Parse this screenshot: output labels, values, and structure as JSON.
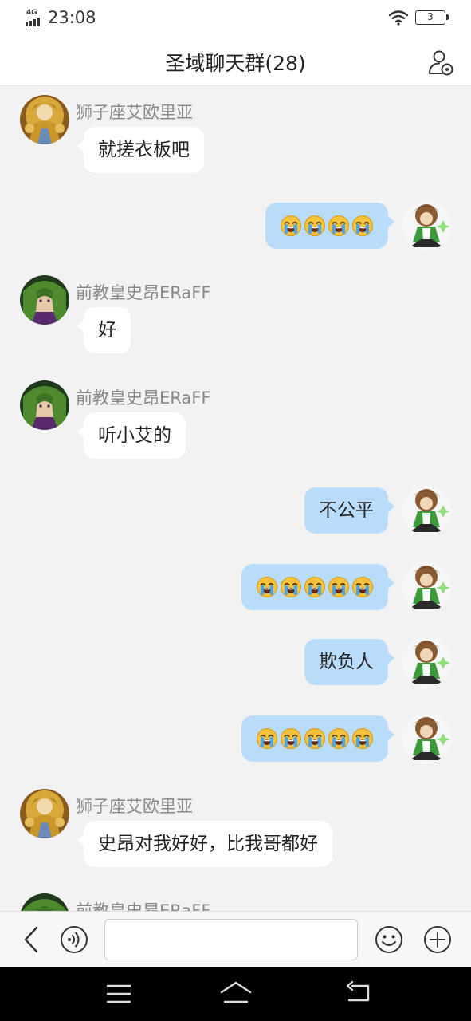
{
  "status_bar": {
    "network": "4G",
    "time": "23:08",
    "battery": "3"
  },
  "header": {
    "title": "圣域聊天群(28)"
  },
  "messages": [
    {
      "direction": "in",
      "sender": "狮子座艾欧里亚",
      "text": "就搓衣板吧"
    },
    {
      "direction": "out",
      "emoji": [
        "loudly-crying-face",
        "loudly-crying-face",
        "loudly-crying-face",
        "loudly-crying-face"
      ]
    },
    {
      "direction": "in",
      "sender": "前教皇史昂ERaFF",
      "text": "好"
    },
    {
      "direction": "in",
      "sender": "前教皇史昂ERaFF",
      "text": "听小艾的"
    },
    {
      "direction": "out",
      "text": "不公平"
    },
    {
      "direction": "out",
      "emoji": [
        "loudly-crying-face",
        "loudly-crying-face",
        "loudly-crying-face",
        "loudly-crying-face",
        "loudly-crying-face"
      ]
    },
    {
      "direction": "out",
      "text": "欺负人"
    },
    {
      "direction": "out",
      "emoji": [
        "loudly-crying-face",
        "loudly-crying-face",
        "loudly-crying-face",
        "loudly-crying-face",
        "loudly-crying-face"
      ]
    },
    {
      "direction": "in",
      "sender": "狮子座艾欧里亚",
      "text": "史昂对我好好，比我哥都好"
    },
    {
      "direction": "in",
      "sender": "前教皇史昂ERaFF",
      "text": ""
    }
  ],
  "input_bar": {
    "message_value": ""
  },
  "colors": {
    "outgoing_bubble": "#b9dcfb",
    "incoming_bubble": "#ffffff",
    "background": "#f2f2f2",
    "nav_bar": "#000000"
  },
  "icons": [
    "signal-icon",
    "wifi-icon",
    "battery-icon",
    "group-settings-icon",
    "back-icon",
    "voice-icon",
    "emoji-icon",
    "plus-icon",
    "menu-icon",
    "home-icon",
    "nav-back-icon",
    "loudly-crying-face"
  ]
}
